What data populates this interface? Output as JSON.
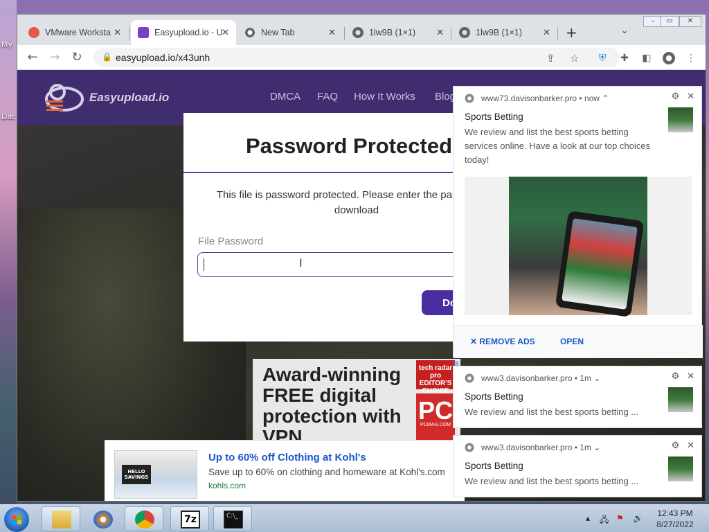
{
  "desktop": {
    "labels": [
      "My",
      "Dat"
    ]
  },
  "browser": {
    "tabs": [
      {
        "title": "VMware Worksta",
        "active": false
      },
      {
        "title": "Easyupload.io - U",
        "active": true
      },
      {
        "title": "New Tab",
        "active": false
      },
      {
        "title": "1lw9B (1×1)",
        "active": false
      },
      {
        "title": "1lw9B (1×1)",
        "active": false
      }
    ],
    "url": "easyupload.io/x43unh",
    "new_tab_icon": "plus-icon"
  },
  "site": {
    "logo": "Easyupload.io",
    "nav": [
      "DMCA",
      "FAQ",
      "How It Works",
      "Blog"
    ]
  },
  "modal": {
    "title": "Password Protected",
    "message": "This file is password protected. Please enter the password to download",
    "field_label": "File Password",
    "field_value": "",
    "button_label": "Download"
  },
  "ads": {
    "vpn": {
      "headline": "Award-winning FREE digital protection with VPN",
      "badge_top": "tech radar pro EDITOR'S CHOICE",
      "badge_pc": "PC",
      "badge_pc_sub": "PCMAG.COM"
    },
    "kohls": {
      "thumb_text": "HELLO SAVINGS",
      "title": "Up to 60% off Clothing at Kohl's",
      "description": "Save up to 60% on clothing and homeware at Kohl's.com",
      "domain": "kohls.com"
    }
  },
  "notifications": [
    {
      "site": "www73.davisonbarker.pro",
      "time": "now",
      "title": "Sports Betting",
      "body": "We review and list the best sports betting services online. Have a look at our top choices today!",
      "actions": [
        "REMOVE ADS",
        "OPEN"
      ]
    },
    {
      "site": "www3.davisonbarker.pro",
      "time": "1m",
      "title": "Sports Betting",
      "body": "We review and list the best sports betting ..."
    },
    {
      "site": "www3.davisonbarker.pro",
      "time": "1m",
      "title": "Sports Betting",
      "body": "We review and list the best sports betting ..."
    }
  ],
  "taskbar": {
    "time": "12:43 PM",
    "date": "8/27/2022",
    "apps": [
      "explorer-icon",
      "media-player-icon",
      "chrome-icon",
      "7zip-icon",
      "cmd-icon"
    ]
  }
}
